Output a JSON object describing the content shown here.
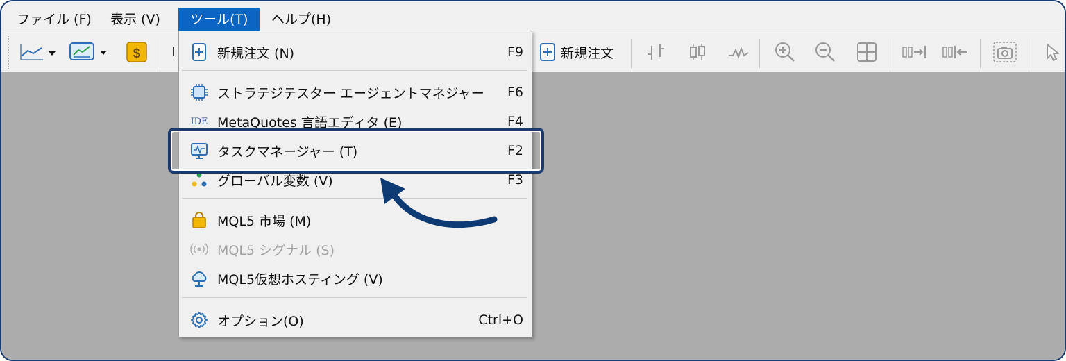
{
  "menubar": {
    "items": [
      {
        "label": "ファイル (F)"
      },
      {
        "label": "表示 (V)"
      },
      {
        "label": "ツール(T)"
      },
      {
        "label": "ヘルプ(H)"
      }
    ]
  },
  "toolbar": {
    "new_order_label": "新規注文",
    "partial_left_char": "I"
  },
  "dropdown": {
    "items": [
      {
        "label": "新規注文 (N)",
        "shortcut": "F9",
        "icon": "new-order-icon"
      },
      {
        "label": "ストラテジテスター エージェントマネジャー",
        "shortcut": "F6",
        "icon": "chip-icon"
      },
      {
        "label": "MetaQuotes 言語エディタ (E)",
        "shortcut": "F4",
        "icon": "ide-icon",
        "icon_text": "IDE"
      },
      {
        "label": "タスクマネージャー (T)",
        "shortcut": "F2",
        "icon": "monitor-icon"
      },
      {
        "label": "グローバル変数 (V)",
        "shortcut": "F3",
        "icon": "global-variables-icon"
      },
      {
        "label": "MQL5 市場 (M)",
        "shortcut": "",
        "icon": "shopping-bag-icon"
      },
      {
        "label": "MQL5 シグナル (S)",
        "shortcut": "",
        "icon": "signal-icon",
        "disabled": true
      },
      {
        "label": "MQL5仮想ホスティング (V)",
        "shortcut": "",
        "icon": "cloud-icon"
      },
      {
        "label": "オプション(O)",
        "shortcut": "Ctrl+O",
        "icon": "gear-icon"
      }
    ]
  },
  "colors": {
    "accent": "#0a66c2",
    "highlight_border": "#1b3a6b",
    "workspace": "#acacac"
  }
}
